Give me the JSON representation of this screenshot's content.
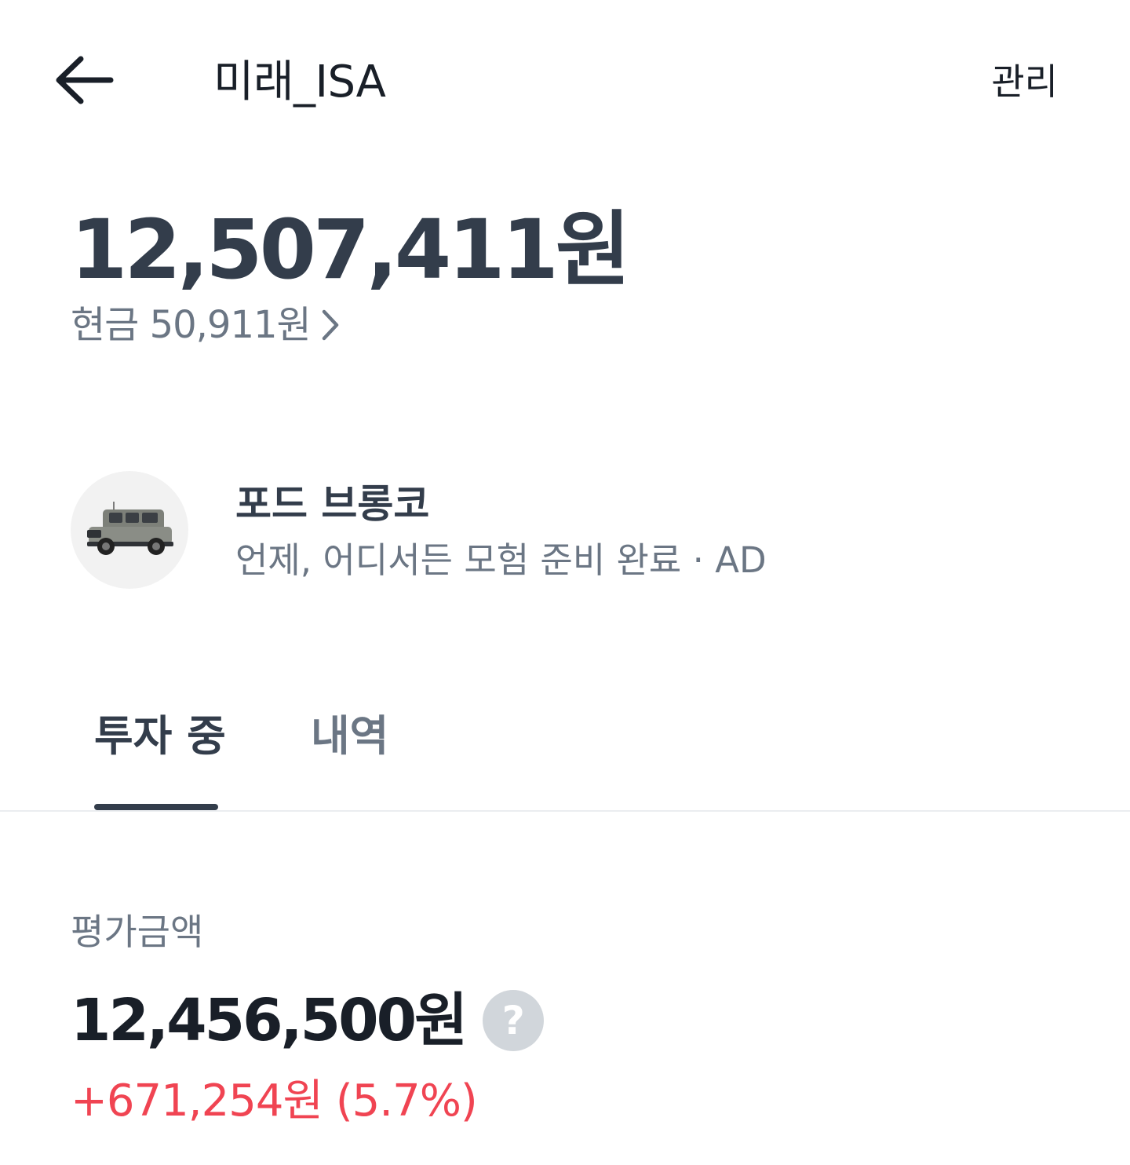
{
  "header": {
    "back_icon": "arrow-left-icon",
    "title": "미래_ISA",
    "manage_label": "관리"
  },
  "summary": {
    "total_amount": "12,507,411원",
    "cash_label": "현금 50,911원",
    "cash_chevron_icon": "chevron-right-icon"
  },
  "ad": {
    "thumbnail_icon": "car-icon",
    "title": "포드 브롱코",
    "subtitle": "언제, 어디서든 모험 준비 완료 · AD"
  },
  "tabs": [
    {
      "label": "투자 중",
      "active": true
    },
    {
      "label": "내역",
      "active": false
    }
  ],
  "evaluation": {
    "label": "평가금액",
    "amount": "12,456,500원",
    "help_icon": "question-icon",
    "change": "+671,254원 (5.7%)"
  },
  "colors": {
    "primary_text": "#191f28",
    "secondary_text": "#6b7684",
    "positive_change": "#f04452",
    "tab_indicator": "#333d4b"
  }
}
